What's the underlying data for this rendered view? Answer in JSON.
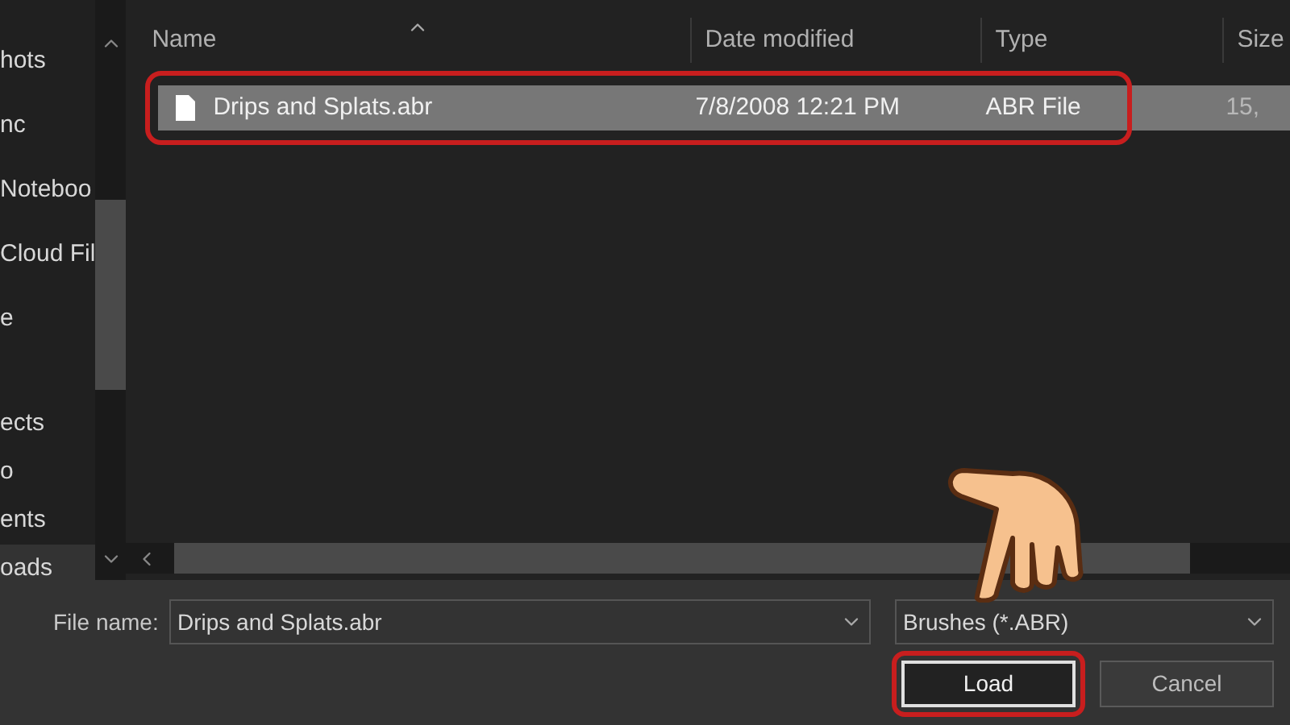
{
  "sidebar": {
    "groups": [
      {
        "items": [
          {
            "label": "hots",
            "selected": false
          },
          {
            "label": "nc",
            "selected": false
          },
          {
            "label": "Noteboo",
            "selected": false
          },
          {
            "label": "Cloud Fil",
            "selected": false
          },
          {
            "label": "e",
            "selected": false
          }
        ]
      },
      {
        "items": [
          {
            "label": "ects",
            "selected": false
          },
          {
            "label": "o",
            "selected": false
          },
          {
            "label": "ents",
            "selected": false
          },
          {
            "label": "oads",
            "selected": true
          }
        ]
      }
    ]
  },
  "table": {
    "columns": [
      "Name",
      "Date modified",
      "Type",
      "Size"
    ],
    "rows": [
      {
        "name": "Drips and Splats.abr",
        "date": "7/8/2008 12:21 PM",
        "type": "ABR File",
        "size": "15,",
        "selected": true,
        "highlighted": true
      }
    ]
  },
  "file_name": {
    "label": "File name:",
    "value": "Drips and Splats.abr"
  },
  "file_type": {
    "value": "Brushes (*.ABR)"
  },
  "buttons": [
    {
      "label": "Load",
      "kind": "primary",
      "highlighted": true
    },
    {
      "label": "Cancel",
      "kind": "secondary",
      "highlighted": false
    }
  ]
}
